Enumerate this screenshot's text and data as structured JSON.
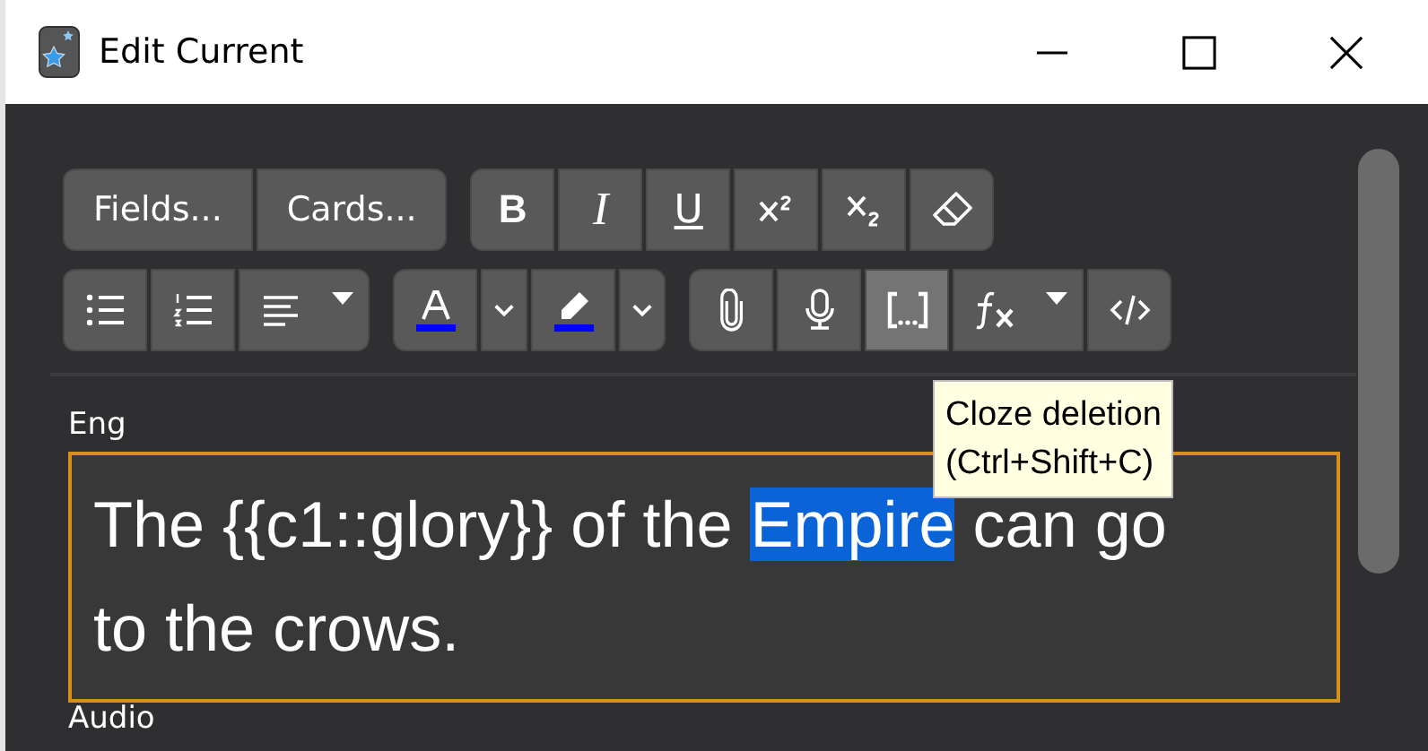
{
  "window": {
    "title": "Edit Current"
  },
  "toolbar": {
    "rows": [
      [
        {
          "buttons": [
            {
              "kind": "text",
              "label": "Fields..."
            },
            {
              "kind": "text",
              "label": "Cards..."
            }
          ]
        },
        {
          "buttons": [
            {
              "kind": "bold",
              "label": "B"
            },
            {
              "kind": "italic",
              "label": "I"
            },
            {
              "kind": "underline",
              "label": "U"
            },
            {
              "kind": "superscript"
            },
            {
              "kind": "subscript"
            },
            {
              "kind": "eraser"
            }
          ]
        }
      ],
      [
        {
          "buttons": [
            {
              "kind": "bullets"
            },
            {
              "kind": "numbered"
            },
            {
              "kind": "align",
              "has_menu": true
            }
          ]
        },
        {
          "buttons": [
            {
              "kind": "font-color",
              "color": "#0000ff"
            },
            {
              "kind": "caret"
            },
            {
              "kind": "highlight",
              "color": "#0000ff"
            },
            {
              "kind": "caret"
            }
          ]
        },
        {
          "buttons": [
            {
              "kind": "attach"
            },
            {
              "kind": "mic"
            },
            {
              "kind": "cloze",
              "hovered": true
            },
            {
              "kind": "formula",
              "has_menu": true
            },
            {
              "kind": "html"
            }
          ]
        }
      ]
    ]
  },
  "tooltip": {
    "lines": [
      "Cloze deletion",
      "(Ctrl+Shift+C)"
    ]
  },
  "fields": [
    {
      "label": "Eng",
      "focused": true,
      "lines": [
        {
          "segments": [
            {
              "text": "The {{c1::glory}} of the ",
              "selected": false
            },
            {
              "text": "Empire",
              "selected": true
            },
            {
              "text": " can go",
              "selected": false
            }
          ]
        },
        {
          "segments": [
            {
              "text": "to the crows.",
              "selected": false
            }
          ]
        }
      ]
    },
    {
      "label": "Audio"
    }
  ]
}
